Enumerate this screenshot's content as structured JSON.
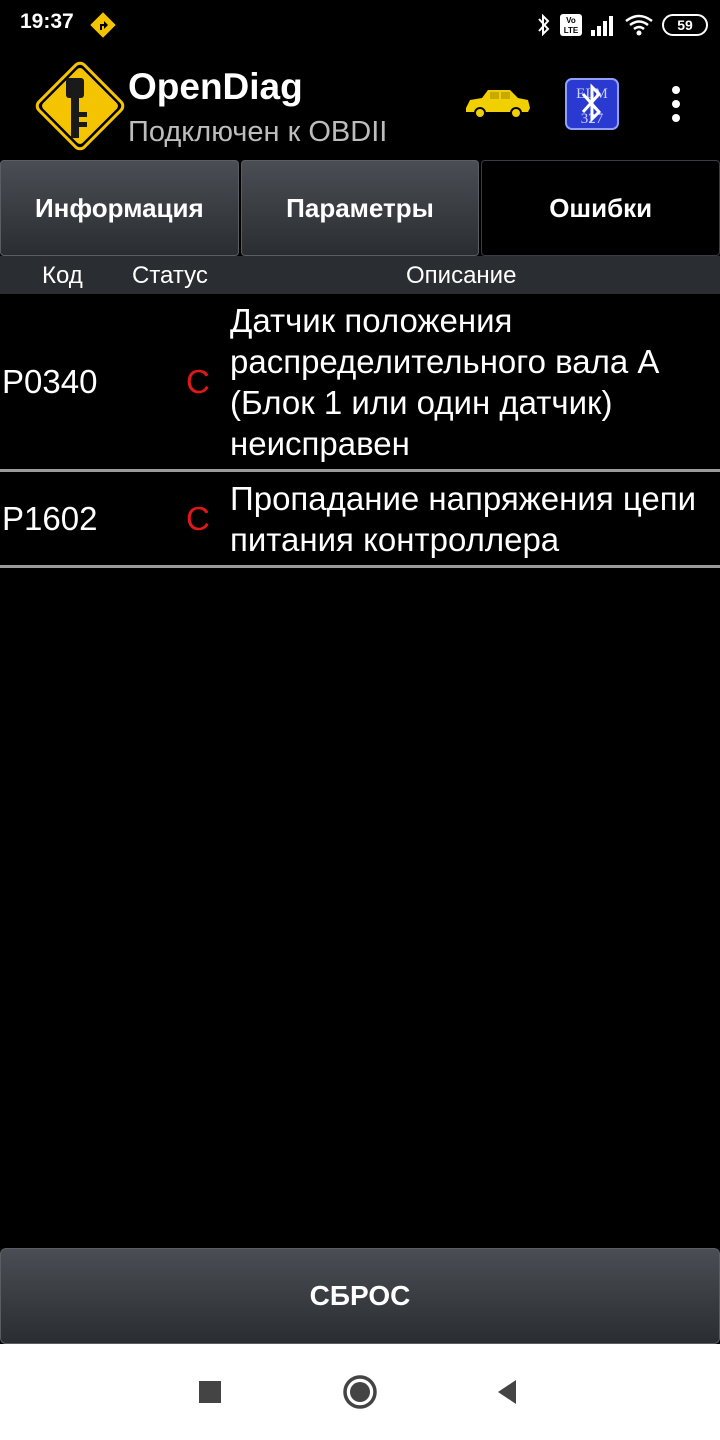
{
  "status_bar": {
    "time": "19:37",
    "battery": "59",
    "volte": "Vo LTE"
  },
  "app_bar": {
    "title": "OpenDiag",
    "subtitle": "Подключен к OBDII",
    "elm_label_top": "ELM",
    "elm_label_bottom": "327"
  },
  "tabs": [
    {
      "label": "Информация",
      "active": false
    },
    {
      "label": "Параметры",
      "active": false
    },
    {
      "label": "Ошибки",
      "active": true
    }
  ],
  "columns": {
    "code": "Код",
    "status": "Статус",
    "description": "Описание"
  },
  "errors": [
    {
      "code": "P0340",
      "status": "C",
      "description": "Датчик положения распределительного вала A (Блок 1 или один датчик) неисправен"
    },
    {
      "code": "P1602",
      "status": "C",
      "description": "Пропадание напряжения цепи питания контроллера"
    }
  ],
  "reset_button": {
    "label": "СБРОС"
  },
  "colors": {
    "status_error": "#e01818",
    "car_icon": "#f0d000",
    "logo_yellow": "#f5c400"
  },
  "icons": {
    "status_left": "warning-navigation-icon",
    "bluetooth": "bluetooth-icon",
    "signal": "signal-icon",
    "wifi": "wifi-icon",
    "logo": "key-sign-logo",
    "car": "car-icon",
    "elm": "elm327-bluetooth-icon",
    "menu": "more-vert-icon",
    "nav_recents": "recents-icon",
    "nav_home": "home-icon",
    "nav_back": "back-icon"
  }
}
